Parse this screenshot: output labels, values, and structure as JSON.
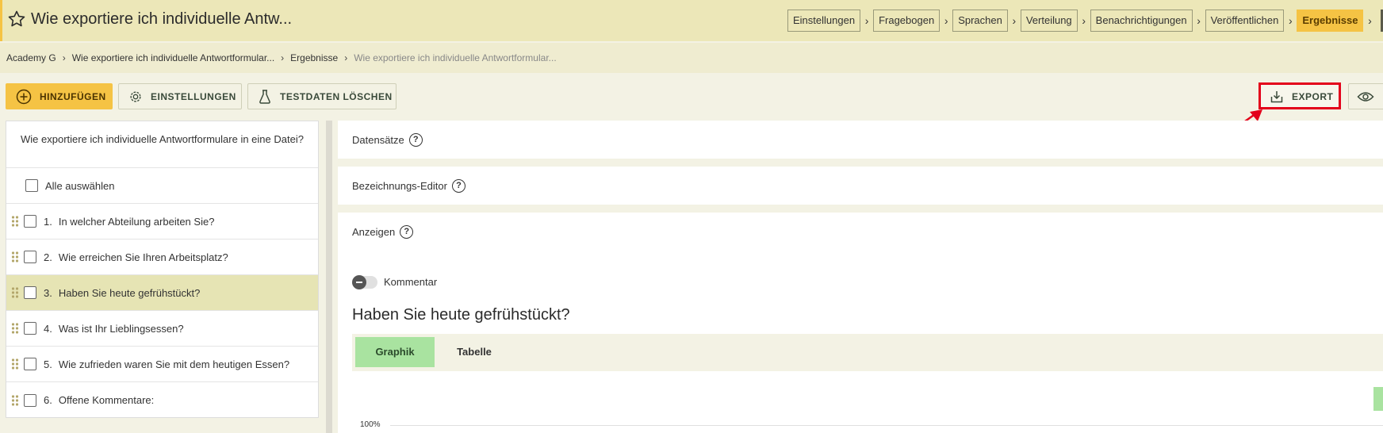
{
  "header": {
    "title": "Wie exportiere ich individuelle Antw...",
    "steps": [
      "Einstellungen",
      "Fragebogen",
      "Sprachen",
      "Verteilung",
      "Benachrichtigungen",
      "Veröffentlichen",
      "Ergebnisse"
    ],
    "active_step": "Ergebnisse"
  },
  "breadcrumb": [
    "Academy G",
    "Wie exportiere ich individuelle Antwortformular...",
    "Ergebnisse",
    "Wie exportiere ich individuelle Antwortformular..."
  ],
  "toolbar": {
    "add_label": "HINZUFÜGEN",
    "settings_label": "EINSTELLUNGEN",
    "testdata_label": "TESTDATEN LÖSCHEN",
    "export_label": "EXPORT"
  },
  "questions": {
    "header": "Wie exportiere ich individuelle Antwortformulare in eine Datei?",
    "select_all": "Alle auswählen",
    "items": [
      {
        "num": "1.",
        "text": "In welcher Abteilung arbeiten Sie?"
      },
      {
        "num": "2.",
        "text": "Wie erreichen Sie Ihren Arbeitsplatz?"
      },
      {
        "num": "3.",
        "text": "Haben Sie heute gefrühstückt?"
      },
      {
        "num": "4.",
        "text": "Was ist Ihr Lieblingsessen?"
      },
      {
        "num": "5.",
        "text": "Wie zufrieden waren Sie mit dem heutigen Essen?"
      },
      {
        "num": "6.",
        "text": "Offene Kommentare:"
      }
    ],
    "selected_index": 2
  },
  "content": {
    "datensaetze": "Datensätze",
    "bezeichnungs_editor": "Bezeichnungs-Editor",
    "anzeigen": "Anzeigen",
    "comment_toggle": "Kommentar",
    "question_title": "Haben Sie heute gefrühstückt?",
    "tabs": [
      "Graphik",
      "Tabelle"
    ],
    "active_tab": "Graphik",
    "axis_top": "100%",
    "help_symbol": "?"
  },
  "colors": {
    "accent": "#f5c344",
    "header_bg": "#ece7b8",
    "selected_row": "#e6e4b4",
    "tab_active": "#a9e3a0",
    "highlight": "#e3001b"
  }
}
